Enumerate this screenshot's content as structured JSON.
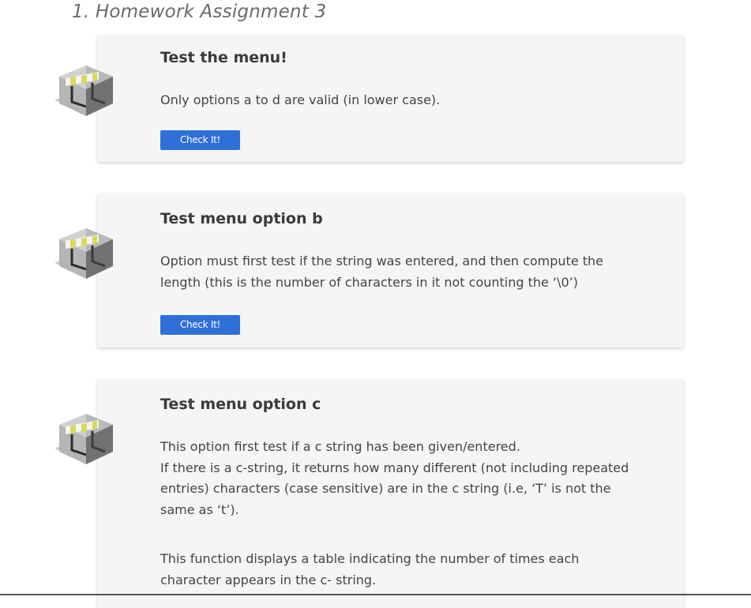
{
  "section": {
    "title": "1. Homework Assignment 3"
  },
  "colors": {
    "card_bg": "#f3f6f4",
    "button": "#2f6fd8",
    "title_text": "#3a3a3a"
  },
  "cards": [
    {
      "icon": "construction-barrier-icon",
      "title": "Test the menu!",
      "text": "Only options a to d are valid (in lower case).",
      "button": "Check It!"
    },
    {
      "icon": "construction-barrier-icon",
      "title": "Test menu option b",
      "text": "Option must first test if the string was entered, and then compute the length (this is the number of characters in it not counting the ‘\\0’)",
      "button": "Check It!"
    },
    {
      "icon": "construction-barrier-icon",
      "title": "Test menu option c",
      "text_lines": [
        "This option first test if a c string has been given/entered.",
        "If there is a c-string, it returns how many different (not including repeated entries) characters (case sensitive) are in the c string (i.e, ‘T’ is not the same as ‘t’)."
      ],
      "text2": "This function displays a table indicating the number of times each character appears in the c- string."
    }
  ]
}
